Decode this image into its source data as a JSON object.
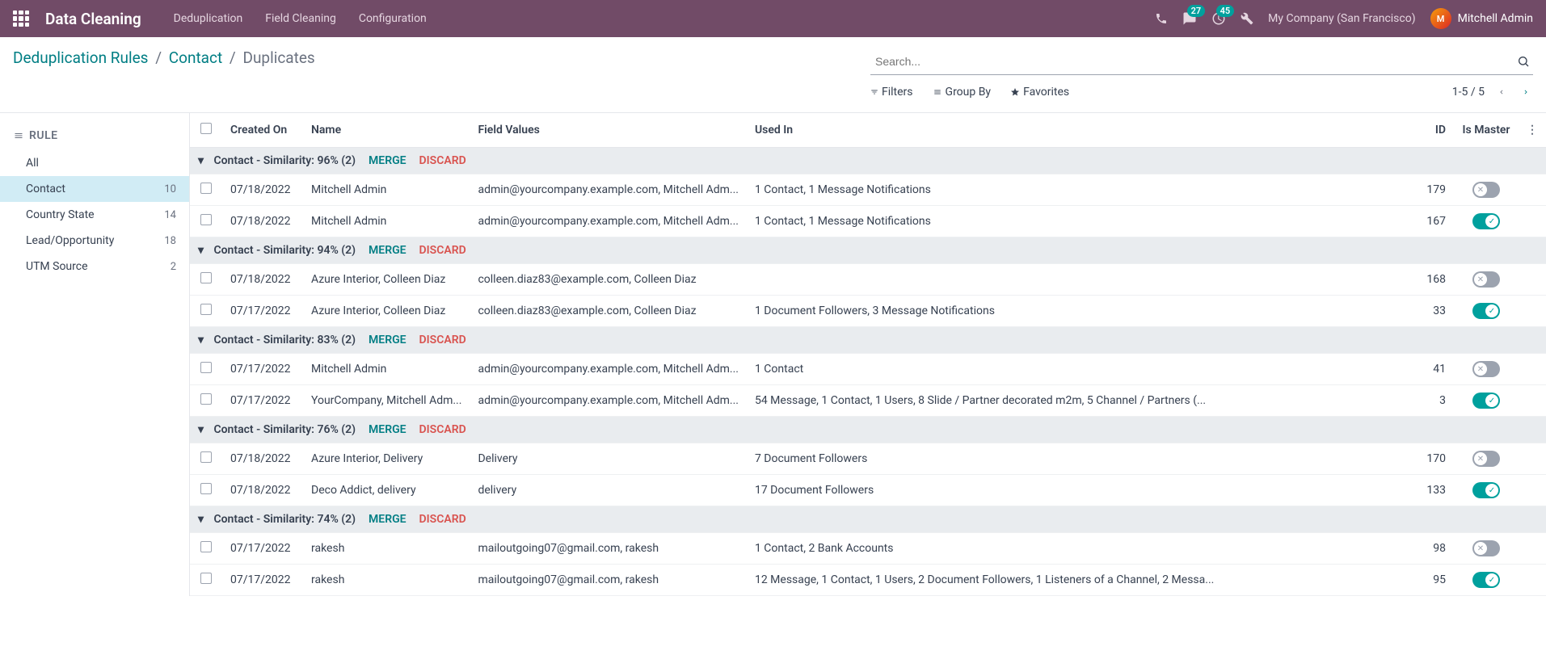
{
  "navbar": {
    "title": "Data Cleaning",
    "menu": [
      "Deduplication",
      "Field Cleaning",
      "Configuration"
    ],
    "discuss_badge": "27",
    "activity_badge": "45",
    "company": "My Company (San Francisco)",
    "user": "Mitchell Admin"
  },
  "breadcrumb": {
    "parts": [
      "Deduplication Rules",
      "Contact",
      "Duplicates"
    ]
  },
  "search": {
    "placeholder": "Search...",
    "filters": "Filters",
    "groupby": "Group By",
    "favorites": "Favorites",
    "pager": "1-5 / 5"
  },
  "sidebar": {
    "header": "RULE",
    "items": [
      {
        "label": "All",
        "count": ""
      },
      {
        "label": "Contact",
        "count": "10",
        "active": true
      },
      {
        "label": "Country State",
        "count": "14"
      },
      {
        "label": "Lead/Opportunity",
        "count": "18"
      },
      {
        "label": "UTM Source",
        "count": "2"
      }
    ]
  },
  "table": {
    "headers": {
      "created_on": "Created On",
      "name": "Name",
      "field_values": "Field Values",
      "used_in": "Used In",
      "id": "ID",
      "is_master": "Is Master"
    },
    "actions": {
      "merge": "MERGE",
      "discard": "DISCARD"
    },
    "groups": [
      {
        "title": "Contact - Similarity: 96% (2)",
        "rows": [
          {
            "created": "07/18/2022",
            "name": "Mitchell Admin",
            "field": "admin@yourcompany.example.com, Mitchell Adm...",
            "used": "1 Contact, 1 Message Notifications",
            "id": "179",
            "master": false
          },
          {
            "created": "07/18/2022",
            "name": "Mitchell Admin",
            "field": "admin@yourcompany.example.com, Mitchell Adm...",
            "used": "1 Contact, 1 Message Notifications",
            "id": "167",
            "master": true
          }
        ]
      },
      {
        "title": "Contact - Similarity: 94% (2)",
        "rows": [
          {
            "created": "07/18/2022",
            "name": "Azure Interior, Colleen Diaz",
            "field": "colleen.diaz83@example.com, Colleen Diaz",
            "used": "",
            "id": "168",
            "master": false
          },
          {
            "created": "07/17/2022",
            "name": "Azure Interior, Colleen Diaz",
            "field": "colleen.diaz83@example.com, Colleen Diaz",
            "used": "1 Document Followers, 3 Message Notifications",
            "id": "33",
            "master": true
          }
        ]
      },
      {
        "title": "Contact - Similarity: 83% (2)",
        "rows": [
          {
            "created": "07/17/2022",
            "name": "Mitchell Admin",
            "field": "admin@yourcompany.example.com, Mitchell Adm...",
            "used": "1 Contact",
            "id": "41",
            "master": false
          },
          {
            "created": "07/17/2022",
            "name": "YourCompany, Mitchell Adm...",
            "field": "admin@yourcompany.example.com, Mitchell Adm...",
            "used": "54 Message, 1 Contact, 1 Users, 8 Slide / Partner decorated m2m, 5 Channel / Partners (...",
            "id": "3",
            "master": true
          }
        ]
      },
      {
        "title": "Contact - Similarity: 76% (2)",
        "rows": [
          {
            "created": "07/18/2022",
            "name": "Azure Interior, Delivery",
            "field": "Delivery",
            "used": "7 Document Followers",
            "id": "170",
            "master": false
          },
          {
            "created": "07/18/2022",
            "name": "Deco Addict, delivery",
            "field": "delivery",
            "used": "17 Document Followers",
            "id": "133",
            "master": true
          }
        ]
      },
      {
        "title": "Contact - Similarity: 74% (2)",
        "rows": [
          {
            "created": "07/17/2022",
            "name": "rakesh",
            "field": "mailoutgoing07@gmail.com, rakesh",
            "used": "1 Contact, 2 Bank Accounts",
            "id": "98",
            "master": false
          },
          {
            "created": "07/17/2022",
            "name": "rakesh",
            "field": "mailoutgoing07@gmail.com, rakesh",
            "used": "12 Message, 1 Contact, 1 Users, 2 Document Followers, 1 Listeners of a Channel, 2 Messa...",
            "id": "95",
            "master": true
          }
        ]
      }
    ]
  }
}
